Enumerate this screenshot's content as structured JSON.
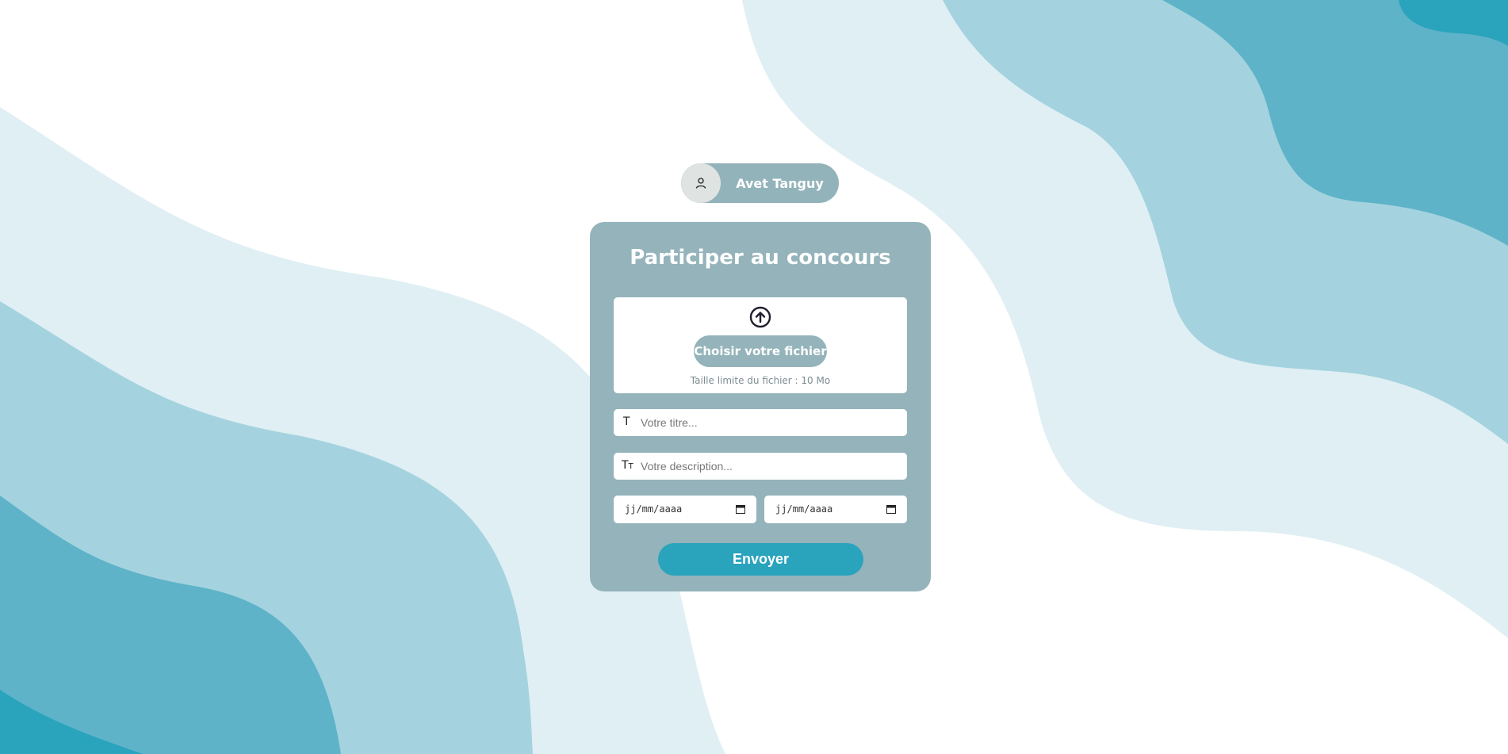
{
  "colors": {
    "card": "#94b3ba",
    "accent": "#2aa3bd",
    "wave_light": "#e0eff4",
    "wave_mid": "#a4d3df",
    "wave_dark": "#5eb3c8",
    "wave_darkest": "#2aa3bd"
  },
  "user": {
    "name": "Avet Tanguy",
    "avatar_icon": "user-icon"
  },
  "form": {
    "title": "Participer au concours",
    "upload": {
      "icon": "arrow-up-circle-icon",
      "button_label": "Choisir votre fichier",
      "hint": "Taille limite du fichier : 10 Mo"
    },
    "title_field": {
      "icon": "text-icon",
      "placeholder": "Votre titre..."
    },
    "description_field": {
      "icon": "text-size-icon",
      "placeholder": "Votre description..."
    },
    "start_date": {
      "placeholder": "jj/mm/aaaa",
      "icon": "calendar-icon"
    },
    "end_date": {
      "placeholder": "jj/mm/aaaa",
      "icon": "calendar-icon"
    },
    "submit_label": "Envoyer"
  }
}
